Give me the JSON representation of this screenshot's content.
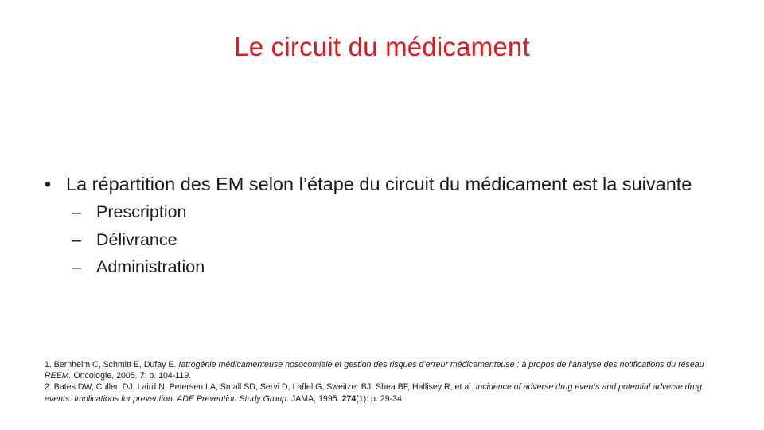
{
  "slide": {
    "title": "Le circuit du médicament",
    "bullet": {
      "marker": "•",
      "text": "La répartition des EM selon l’étape du circuit du médicament est la suivante"
    },
    "sub_marker": "–",
    "sub_items": [
      "Prescription",
      "Délivrance",
      "Administration"
    ]
  },
  "references": [
    {
      "authors": "1. Bernheim C, Schmitt E, Dufay E. ",
      "title": "Iatrogénie médicamenteuse nosocomiale et gestion des risques d’erreur médicamenteuse : à propos de l’analyse des notifications du réseau REEM.",
      "journal": " Oncologie, 2005. ",
      "volume": "7",
      "pages": ": p. 104-119."
    },
    {
      "authors": "2. Bates DW, Cullen DJ, Laird N, Petersen LA, Small SD, Servi D, Laffel G, Sweitzer BJ, Shea BF, Hallisey R, et al. ",
      "title": "Incidence of adverse drug events and potential adverse drug events. Implications for prevention. ADE Prevention Study Group.",
      "journal": " JAMA,  1995. ",
      "volume": "274",
      "pages": "(1): p. 29-34."
    }
  ]
}
